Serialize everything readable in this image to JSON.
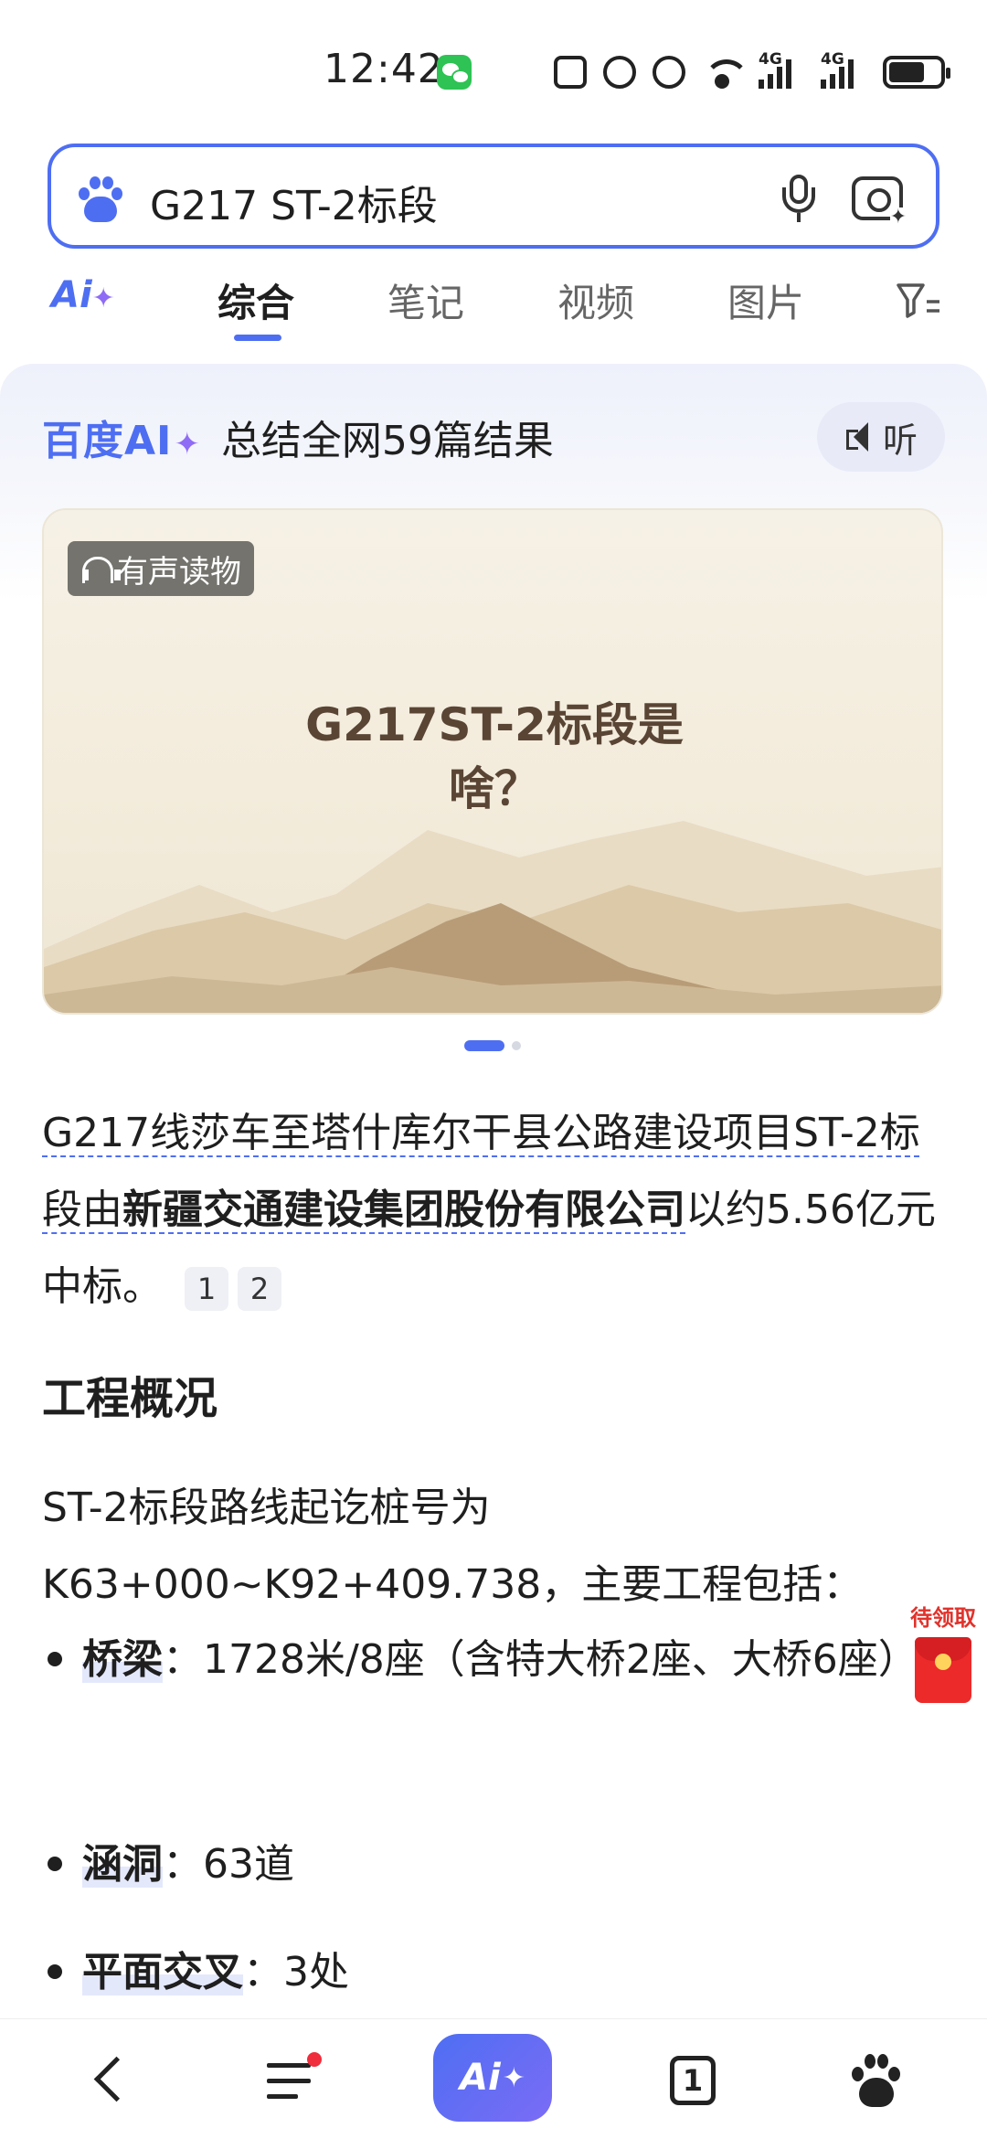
{
  "status_bar": {
    "time": "12:42",
    "network_1": "4G",
    "network_2": "4G"
  },
  "search": {
    "query": "G217 ST-2标段"
  },
  "tabs": {
    "items": [
      "综合",
      "笔记",
      "视频",
      "图片"
    ],
    "active_index": 0
  },
  "ai_summary": {
    "brand": "百度AI",
    "brand_star": "✦",
    "summary_text": "总结全网59篇结果",
    "listen_label": "听"
  },
  "audio_card": {
    "badge": "有声读物",
    "title_line1": "G217ST-2标段是",
    "title_line2": "啥？"
  },
  "answer": {
    "part1": "G217线莎车至塔什库尔干县公路建设项目ST-2标段由",
    "company": "新疆交通建设集团股份有限公司",
    "part2": "以约5.56亿元中标。",
    "citations": [
      "1",
      "2"
    ]
  },
  "section": {
    "title": "工程概况",
    "overview": "ST-2标段路线起讫桩号为K63+000~K92+409.738，主要工程包括："
  },
  "bullets": [
    {
      "term": "桥梁",
      "text": "：1728米/8座（含特大桥2座、大桥6座）"
    },
    {
      "term": "涵洞",
      "text": "：63道"
    },
    {
      "term": "平面交叉",
      "text": "：3处"
    }
  ],
  "red_packet": {
    "label": "待领取"
  },
  "bottom_nav": {
    "ai_label": "Ai",
    "tab_count": "1"
  },
  "colors": {
    "accent": "#4e6ef2",
    "ai_purple": "#8f6cf5",
    "red": "#ec2a2a"
  }
}
